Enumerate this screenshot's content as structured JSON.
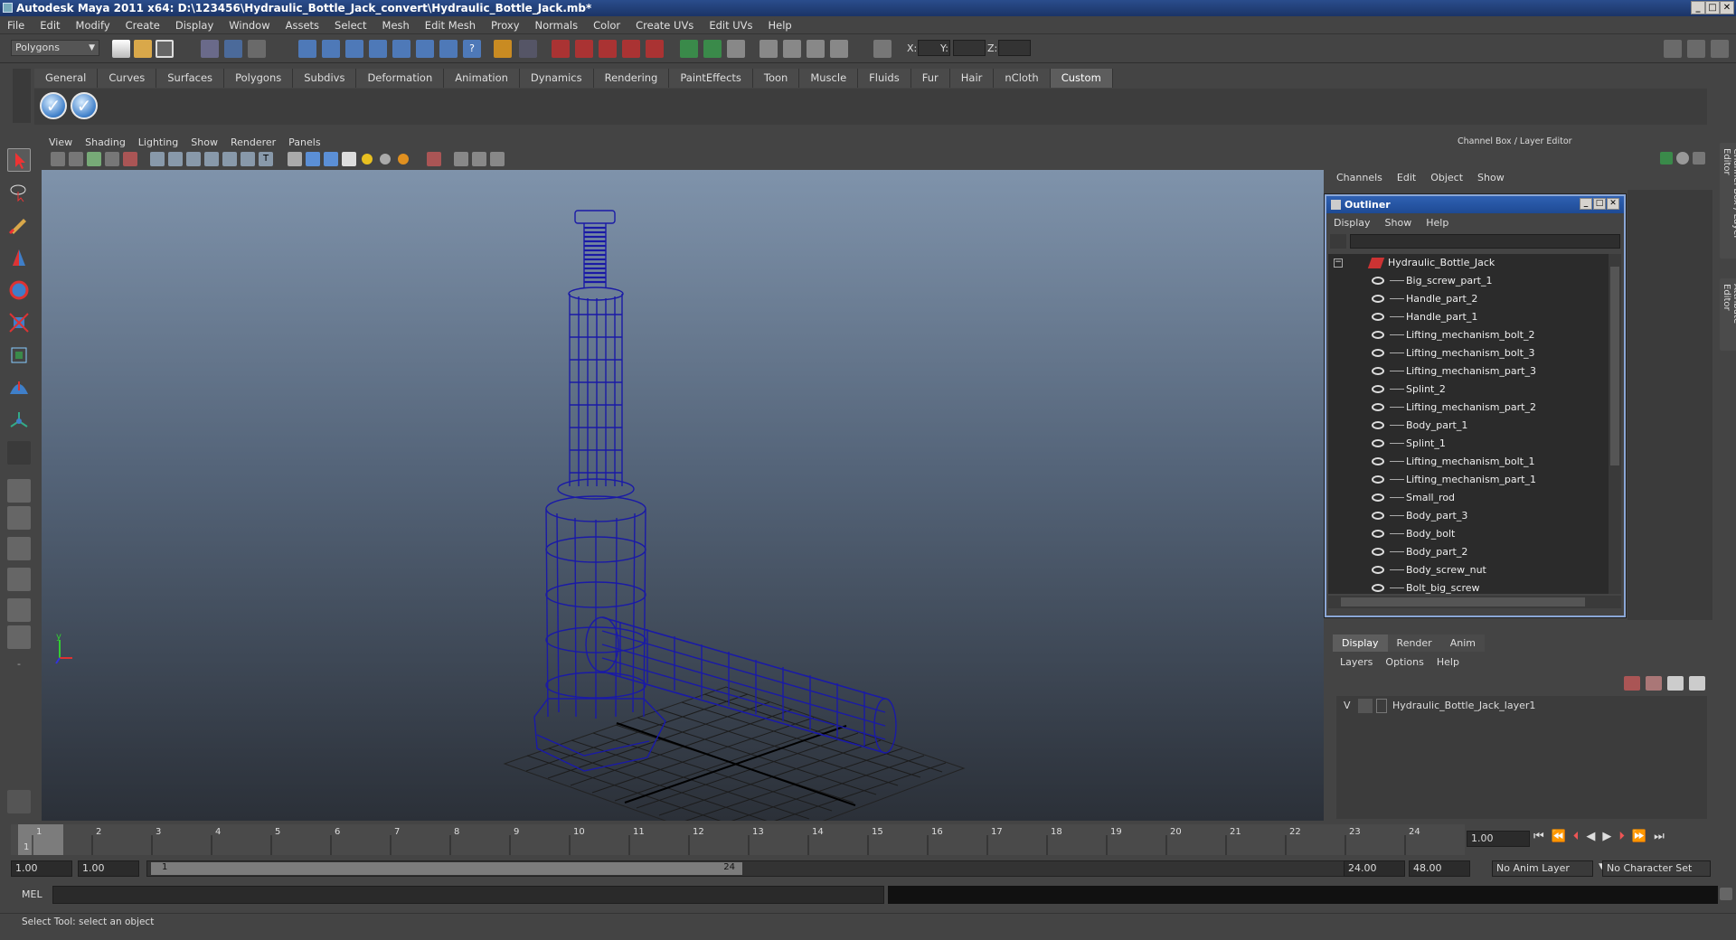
{
  "window": {
    "title": "Autodesk Maya 2011 x64: D:\\123456\\Hydraulic_Bottle_Jack_convert\\Hydraulic_Bottle_Jack.mb*"
  },
  "menu": [
    "File",
    "Edit",
    "Modify",
    "Create",
    "Display",
    "Window",
    "Assets",
    "Select",
    "Mesh",
    "Edit Mesh",
    "Proxy",
    "Normals",
    "Color",
    "Create UVs",
    "Edit UVs",
    "Help"
  ],
  "status": {
    "mode_select": "Polygons",
    "x_label": "X:",
    "y_label": "Y:",
    "z_label": "Z:"
  },
  "shelf_tabs": [
    "General",
    "Curves",
    "Surfaces",
    "Polygons",
    "Subdivs",
    "Deformation",
    "Animation",
    "Dynamics",
    "Rendering",
    "PaintEffects",
    "Toon",
    "Muscle",
    "Fluids",
    "Fur",
    "Hair",
    "nCloth",
    "Custom"
  ],
  "shelf_active": "Custom",
  "viewport_menu": [
    "View",
    "Shading",
    "Lighting",
    "Show",
    "Renderer",
    "Panels"
  ],
  "channel_box": {
    "title": "Channel Box / Layer Editor",
    "menu": [
      "Channels",
      "Edit",
      "Object",
      "Show"
    ]
  },
  "outliner": {
    "title": "Outliner",
    "menu": [
      "Display",
      "Show",
      "Help"
    ],
    "root": "Hydraulic_Bottle_Jack",
    "items": [
      "Big_screw_part_1",
      "Handle_part_2",
      "Handle_part_1",
      "Lifting_mechanism_bolt_2",
      "Lifting_mechanism_bolt_3",
      "Lifting_mechanism_part_3",
      "Splint_2",
      "Lifting_mechanism_part_2",
      "Body_part_1",
      "Splint_1",
      "Lifting_mechanism_bolt_1",
      "Lifting_mechanism_part_1",
      "Small_rod",
      "Body_part_3",
      "Body_bolt",
      "Body_part_2",
      "Body_screw_nut",
      "Bolt_big_screw"
    ]
  },
  "layer_editor": {
    "tabs": [
      "Display",
      "Render",
      "Anim"
    ],
    "menu": [
      "Layers",
      "Options",
      "Help"
    ],
    "layer_visible": "V",
    "layer_name": "Hydraulic_Bottle_Jack_layer1"
  },
  "side_tabs": [
    "Channel Box / Layer Editor",
    "Attribute Editor"
  ],
  "timeline": {
    "ticks": [
      "1",
      "2",
      "3",
      "4",
      "5",
      "6",
      "7",
      "8",
      "9",
      "10",
      "11",
      "12",
      "13",
      "14",
      "15",
      "16",
      "17",
      "18",
      "19",
      "20",
      "21",
      "22",
      "23",
      "24"
    ],
    "current_frame": "1.00",
    "playhead_label": "1"
  },
  "range": {
    "start": "1.00",
    "anim_start": "1.00",
    "slider_start": "1",
    "slider_end": "24",
    "end": "24.00",
    "anim_end": "48.00",
    "anim_layer": "No Anim Layer",
    "character_set": "No Character Set"
  },
  "mel": {
    "label": "MEL"
  },
  "help_line": "Select Tool: select an object"
}
